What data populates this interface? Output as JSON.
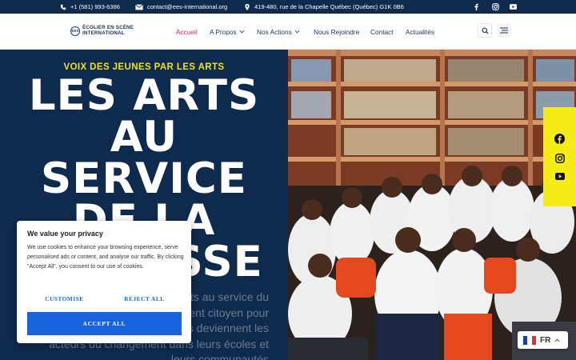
{
  "topbar": {
    "phone": "+1 (581) 993-6386",
    "email": "contact@ees-international.org",
    "address": "419-480, rue de la Chapelle Québec (Québec) G1K 0B6",
    "social_icons": [
      "facebook-icon",
      "instagram-icon",
      "youtube-icon"
    ]
  },
  "logo": {
    "mark": "EES",
    "line1": "ÉCOLIER EN SCÈNE",
    "line2": "INTERNATIONAL"
  },
  "nav": {
    "items": [
      {
        "label": "Accueil",
        "active": true,
        "dropdown": false
      },
      {
        "label": "A Propos",
        "active": false,
        "dropdown": true
      },
      {
        "label": "Nos Actions",
        "active": false,
        "dropdown": true
      },
      {
        "label": "Nous Rejoindre",
        "active": false,
        "dropdown": false
      },
      {
        "label": "Contact",
        "active": false,
        "dropdown": false
      },
      {
        "label": "Actualités",
        "active": false,
        "dropdown": false
      }
    ]
  },
  "hero": {
    "eyebrow": "VOIX DES JEUNES PAR LES ARTS",
    "headline_lines": [
      "LES ARTS",
      "AU",
      "SERVICE",
      "DE LA",
      "JEUNESSE"
    ],
    "paragraph": "Nous mettons les arts au service du développement et de l'engagement citoyen pour permettre aux jeunes pour qu'ils deviennent les acteurs du changement dans leurs écoles et leurs communautés"
  },
  "social_strip": [
    "facebook-icon",
    "instagram-icon",
    "youtube-icon"
  ],
  "cookie": {
    "title": "We value your privacy",
    "text": "We use cookies to enhance your browsing experience, serve personalised ads or content, and analyse our traffic. By clicking \"Accept All\", you consent to our use of cookies.",
    "customise": "CUSTOMISE",
    "reject": "REJECT ALL",
    "accept": "ACCEPT ALL"
  },
  "language": {
    "code": "FR"
  },
  "colors": {
    "navy": "#0e2a4d",
    "accent_red": "#d2244e",
    "yellow": "#f6ec17",
    "cookie_blue": "#1863dc"
  }
}
